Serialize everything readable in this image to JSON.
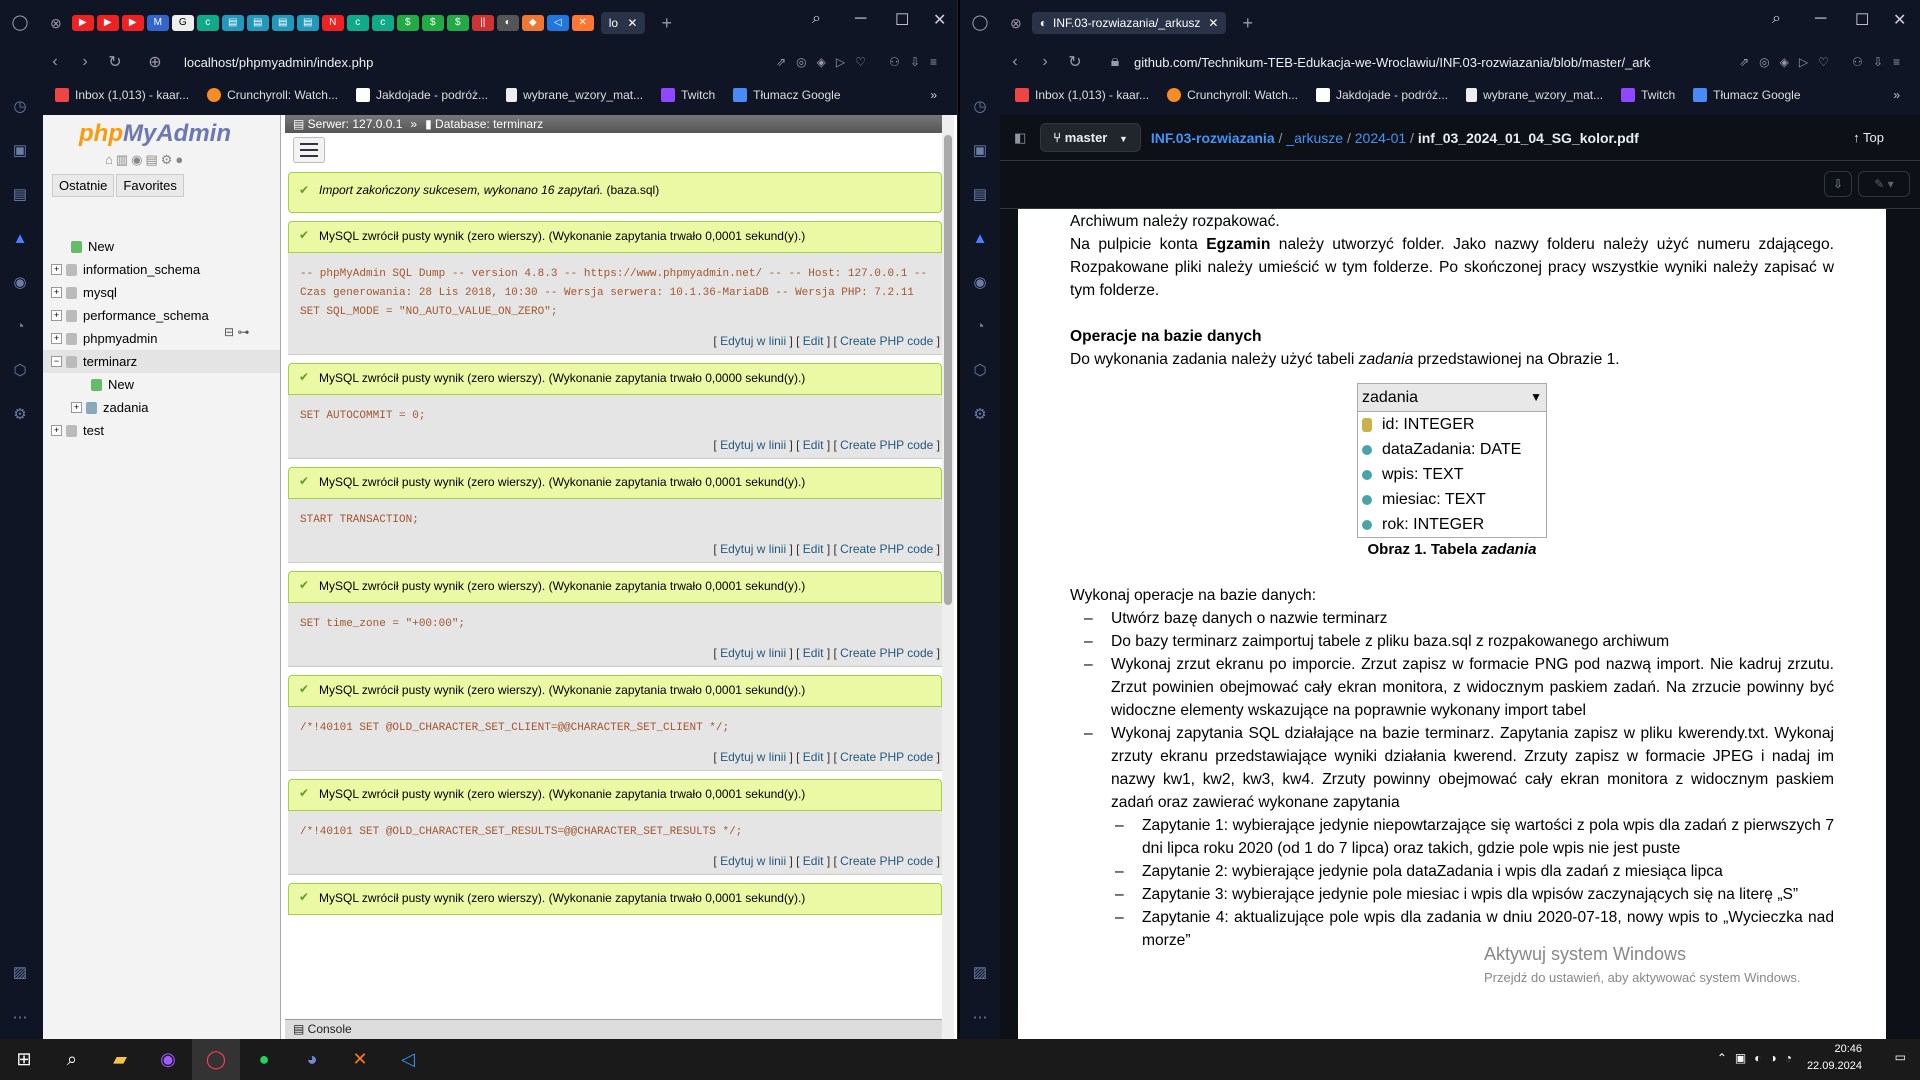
{
  "left_window": {
    "tab_title": "lo",
    "url": "localhost/phpmyadmin/index.php",
    "bookmarks": [
      "Inbox (1,013) - kaar...",
      "Crunchyroll: Watch...",
      "Jakdojade - podróż...",
      "wybrane_wzory_mat...",
      "Twitch",
      "Tłumacz Google"
    ],
    "pma": {
      "logo_a": "php",
      "logo_b": "MyAdmin",
      "nav_tabs": [
        "Ostatnie",
        "Favorites"
      ],
      "tree": [
        "New",
        "information_schema",
        "mysql",
        "performance_schema",
        "phpmyadmin",
        "terminarz",
        "New",
        "zadania",
        "test"
      ],
      "breadcrumb_server": "Serwer: 127.0.0.1",
      "breadcrumb_sep": "»",
      "breadcrumb_db": "Database: terminarz",
      "import_msg": "Import zakończony sukcesem, wykonano 16 zapytań.",
      "import_file": "(baza.sql)",
      "results": [
        {
          "msg": "MySQL zwrócił pusty wynik (zero wierszy). (Wykonanie zapytania trwało 0,0001 sekund(y).)",
          "sql": "-- phpMyAdmin SQL Dump -- version 4.8.3 -- https://www.phpmyadmin.net/ -- -- Host: 127.0.0.1 -- Czas generowania: 28 Lis 2018, 10:30 -- Wersja serwera: 10.1.36-MariaDB -- Wersja PHP: 7.2.11 SET SQL_MODE = \"NO_AUTO_VALUE_ON_ZERO\";"
        },
        {
          "msg": "MySQL zwrócił pusty wynik (zero wierszy). (Wykonanie zapytania trwało 0,0000 sekund(y).)",
          "sql": "SET AUTOCOMMIT = 0;"
        },
        {
          "msg": "MySQL zwrócił pusty wynik (zero wierszy). (Wykonanie zapytania trwało 0,0001 sekund(y).)",
          "sql": "START TRANSACTION;"
        },
        {
          "msg": "MySQL zwrócił pusty wynik (zero wierszy). (Wykonanie zapytania trwało 0,0001 sekund(y).)",
          "sql": "SET time_zone = \"+00:00\";"
        },
        {
          "msg": "MySQL zwrócił pusty wynik (zero wierszy). (Wykonanie zapytania trwało 0,0001 sekund(y).)",
          "sql": "/*!40101 SET @OLD_CHARACTER_SET_CLIENT=@@CHARACTER_SET_CLIENT */;"
        },
        {
          "msg": "MySQL zwrócił pusty wynik (zero wierszy). (Wykonanie zapytania trwało 0,0001 sekund(y).)",
          "sql": "/*!40101 SET @OLD_CHARACTER_SET_RESULTS=@@CHARACTER_SET_RESULTS */;"
        }
      ],
      "last_msg": "MySQL zwrócił pusty wynik (zero wierszy). (Wykonanie zapytania trwało 0,0001 sekund(y).)",
      "act_edit_inline": "Edytuj w linii",
      "act_edit": "Edit",
      "act_php": "Create PHP code",
      "console": "Console"
    }
  },
  "right_window": {
    "tab_title": "INF.03-rozwiazania/_arkusz",
    "url": "github.com/Technikum-TEB-Edukacja-we-Wroclawiu/INF.03-rozwiazania/blob/master/_ark",
    "bookmarks": [
      "Inbox (1,013) - kaar...",
      "Crunchyroll: Watch...",
      "Jakdojade - podróż...",
      "wybrane_wzory_mat...",
      "Twitch",
      "Tłumacz Google"
    ],
    "branch": "master",
    "crumb": [
      "INF.03-rozwiazania",
      "_arkusze",
      "2024-01",
      "inf_03_2024_01_04_SG_kolor.pdf"
    ],
    "crumb_sep": "/",
    "top": "Top",
    "doc": {
      "p1": "Archiwum należy rozpakować.",
      "p2a": "Na pulpicie konta ",
      "p2b": "Egzamin",
      "p2c": " należy utworzyć folder. Jako nazwy folderu należy użyć numeru zdającego. Rozpakowane pliki należy umieścić w tym folderze. Po skończonej pracy wszystkie wyniki należy zapisać w tym folderze.",
      "h1": "Operacje na bazie danych",
      "p3a": "Do wykonania zadania należy użyć tabeli ",
      "p3b": "zadania",
      "p3c": " przedstawionej na Obrazie 1.",
      "table_name": "zadania",
      "fields": [
        "id: INTEGER",
        "dataZadania: DATE",
        "wpis: TEXT",
        "miesiac: TEXT",
        "rok: INTEGER"
      ],
      "caption_a": "Obraz 1. Tabela ",
      "caption_b": "zadania",
      "p4": "Wykonaj operacje na bazie danych:",
      "items": [
        "Utwórz bazę danych o nazwie terminarz",
        "Do bazy terminarz zaimportuj tabele z pliku baza.sql z rozpakowanego archiwum",
        "Wykonaj zrzut ekranu po imporcie. Zrzut zapisz w formacie PNG pod nazwą import. Nie kadruj zrzutu. Zrzut powinien obejmować cały ekran monitora, z widocznym paskiem zadań. Na zrzucie powinny być widoczne elementy wskazujące na poprawnie wykonany import tabel",
        "Wykonaj zapytania SQL działające na bazie terminarz. Zapytania zapisz w pliku kwerendy.txt. Wykonaj zrzuty ekranu przedstawiające wyniki działania kwerend. Zrzuty zapisz w formacie JPEG i nadaj im nazwy kw1, kw2, kw3, kw4. Zrzuty powinny obejmować cały ekran monitora z widocznym paskiem zadań oraz zawierać wykonane zapytania"
      ],
      "subitems": [
        "Zapytanie 1: wybierające jedynie niepowtarzające się wartości z pola wpis dla zadań z pierwszych 7 dni lipca roku 2020 (od 1 do 7 lipca) oraz takich, gdzie pole wpis nie jest puste",
        "Zapytanie 2: wybierające jedynie pola dataZadania i wpis dla zadań z miesiąca lipca",
        "Zapytanie 3: wybierające jedynie pole miesiac i wpis dla wpisów zaczynających się na literę „S”",
        "Zapytanie 4: aktualizujące pole wpis dla zadania w dniu 2020-07-18, nowy wpis to „Wycieczka nad morze”"
      ]
    }
  },
  "watermark": {
    "line1": "Aktywuj system Windows",
    "line2": "Przejdź do ustawień, aby aktywować system Windows."
  },
  "clock": {
    "time": "20:46",
    "date": "22.09.2024"
  }
}
